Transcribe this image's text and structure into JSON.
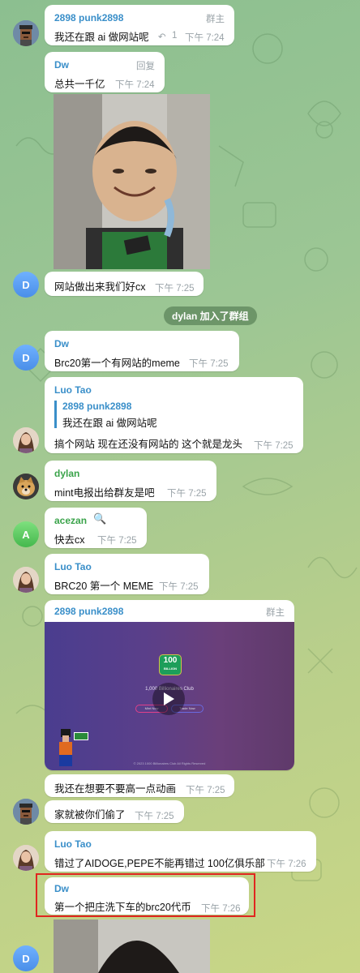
{
  "colors": {
    "accent": "#3a8fc9",
    "highlight_border": "#e0261f",
    "service_bg": "#5c7f5a"
  },
  "messages": {
    "m1": {
      "name": "2898 punk2898",
      "role": "群主",
      "text": "我还在跟 ai 做网站呢",
      "reply_count": "1",
      "time": "下午 7:24"
    },
    "m2": {
      "name": "Dw",
      "role": "回复",
      "text": "总共一千亿",
      "time": "下午 7:24"
    },
    "m3": {
      "text": "网站做出来我们好cx",
      "time": "下午 7:25",
      "avatar_letter": "D"
    },
    "service": {
      "text": "dylan 加入了群组"
    },
    "m4": {
      "name": "Dw",
      "text": "Brc20第一个有网站的meme",
      "time": "下午 7:25",
      "avatar_letter": "D"
    },
    "m5": {
      "name": "Luo Tao",
      "reply_name": "2898 punk2898",
      "reply_text": "我还在跟 ai 做网站呢",
      "text": "搞个网站 现在还没有网站的 这个就是龙头",
      "time": "下午 7:25"
    },
    "m6": {
      "name": "dylan",
      "text": "mint电报出给群友是吧",
      "time": "下午 7:25"
    },
    "m7": {
      "name": "acezan",
      "text": "快去cx",
      "time": "下午 7:25",
      "avatar_letter": "A"
    },
    "m8": {
      "name": "Luo Tao",
      "text": "BRC20 第一个 MEME",
      "time": "下午 7:25"
    },
    "m9": {
      "name": "2898 punk2898",
      "role": "群主",
      "video_badge": "100",
      "video_badge_sub": "BILLION",
      "video_title": "1,000 Billionaires Club",
      "video_btn1": "Mint Now",
      "video_btn2": "Trade Now",
      "video_footer": "© 2023 1000 Billionaires Club All Rights Reserved"
    },
    "m10": {
      "text": "我还在想要不要高一点动画",
      "time": "下午 7:25"
    },
    "m11": {
      "text": "家就被你们偷了",
      "time": "下午 7:25"
    },
    "m12": {
      "name": "Luo Tao",
      "text": "错过了AIDOGE,PEPE不能再错过 100亿俱乐部",
      "time": "下午 7:26"
    },
    "m13": {
      "name": "Dw",
      "text": "第一个把庄洗下车的brc20代币",
      "time": "下午 7:26",
      "avatar_letter": "D"
    }
  }
}
